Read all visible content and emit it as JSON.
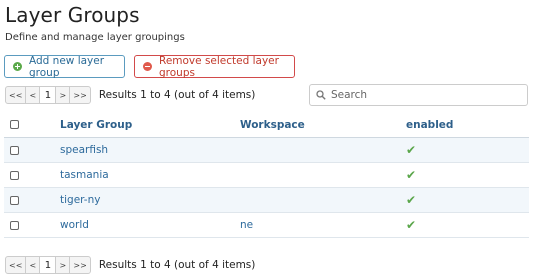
{
  "page": {
    "title": "Layer Groups",
    "subtitle": "Define and manage layer groupings"
  },
  "toolbar": {
    "add_label": "Add new layer group",
    "remove_label": "Remove selected layer groups"
  },
  "pager": {
    "first": "<<",
    "prev": "<",
    "current": "1",
    "next": ">",
    "last": ">>",
    "results_text": "Results 1 to 4 (out of 4 items)"
  },
  "search": {
    "placeholder": "Search"
  },
  "table": {
    "headers": {
      "group": "Layer Group",
      "workspace": "Workspace",
      "enabled": "enabled"
    },
    "rows": [
      {
        "group": "spearfish",
        "workspace": "",
        "enabled": "✔"
      },
      {
        "group": "tasmania",
        "workspace": "",
        "enabled": "✔"
      },
      {
        "group": "tiger-ny",
        "workspace": "",
        "enabled": "✔"
      },
      {
        "group": "world",
        "workspace": "ne",
        "enabled": "✔"
      }
    ]
  },
  "colors": {
    "link": "#2d6a9c",
    "add_accent": "#5ba94a",
    "remove_accent": "#c0392b",
    "enabled_check": "#5aa64a"
  },
  "icons": [
    "add-icon",
    "remove-icon",
    "search-icon",
    "check-icon"
  ]
}
